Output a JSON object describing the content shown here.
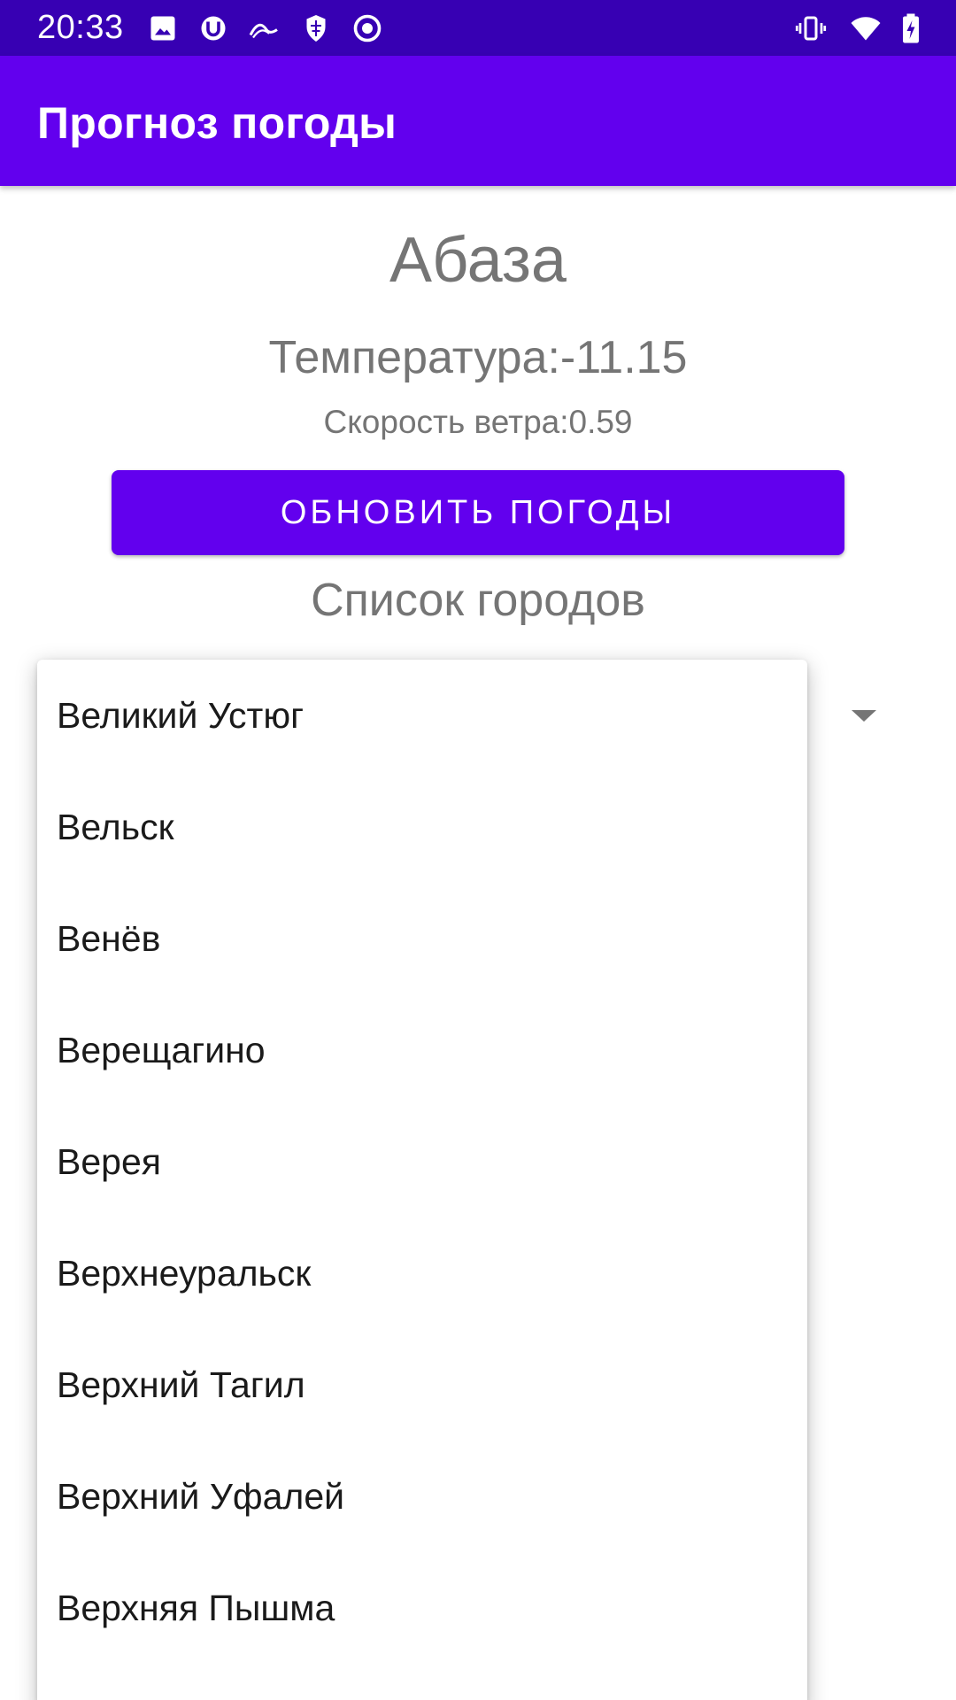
{
  "status_bar": {
    "time": "20:33",
    "background": "#3700b3",
    "left_icons": [
      "image-icon",
      "notification-app-icon",
      "wave-icon",
      "shield-icon",
      "record-icon"
    ],
    "right_icons": [
      "vibrate-icon",
      "wifi-icon",
      "battery-charging-icon"
    ]
  },
  "app_bar": {
    "title": "Прогноз погоды",
    "background": "#6200ee"
  },
  "weather": {
    "city": "Абаза",
    "temperature": "Температура:-11.15",
    "wind": "Скорость ветра:0.59"
  },
  "update_button": {
    "label": "Обновить погоды"
  },
  "cities_section": {
    "title": "Список городов"
  },
  "dropdown": {
    "items": [
      "Великий Устюг",
      "Вельск",
      "Венёв",
      "Верещагино",
      "Верея",
      "Верхнеуральск",
      "Верхний Тагил",
      "Верхний Уфалей",
      "Верхняя Пышма",
      ""
    ]
  },
  "colors": {
    "primary": "#6200ee",
    "primary_dark": "#3700b3",
    "secondary_text": "#757575"
  }
}
